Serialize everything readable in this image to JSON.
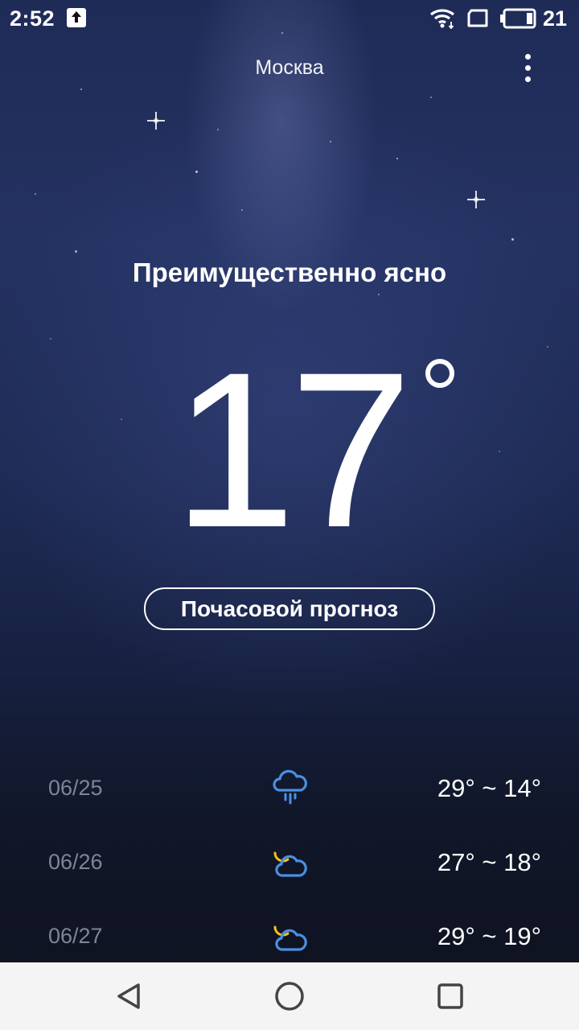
{
  "status_bar": {
    "time": "2:52",
    "battery_level": "21",
    "icons": [
      "upload-icon",
      "wifi-icon",
      "sim-icon",
      "battery-icon"
    ]
  },
  "header": {
    "city": "Москва",
    "menu_icon": "more-vertical-icon"
  },
  "current": {
    "condition": "Преимущественно ясно",
    "temperature": "17",
    "unit_symbol": "°"
  },
  "hourly_button": {
    "label": "Почасовой прогноз"
  },
  "forecast": [
    {
      "date": "06/25",
      "icon": "cloud-rain-icon",
      "range": "29° ~ 14°"
    },
    {
      "date": "06/26",
      "icon": "moon-cloud-icon",
      "range": "27° ~ 18°"
    },
    {
      "date": "06/27",
      "icon": "moon-cloud-icon",
      "range": "29° ~ 19°"
    }
  ],
  "colors": {
    "accent_icon": "#4a8fe0",
    "muted_text": "#7f8597",
    "sky_top": "#1f2b57",
    "sky_bottom": "#0f1322"
  },
  "nav_bar": {
    "buttons": [
      "back-icon",
      "home-icon",
      "recents-icon"
    ]
  }
}
